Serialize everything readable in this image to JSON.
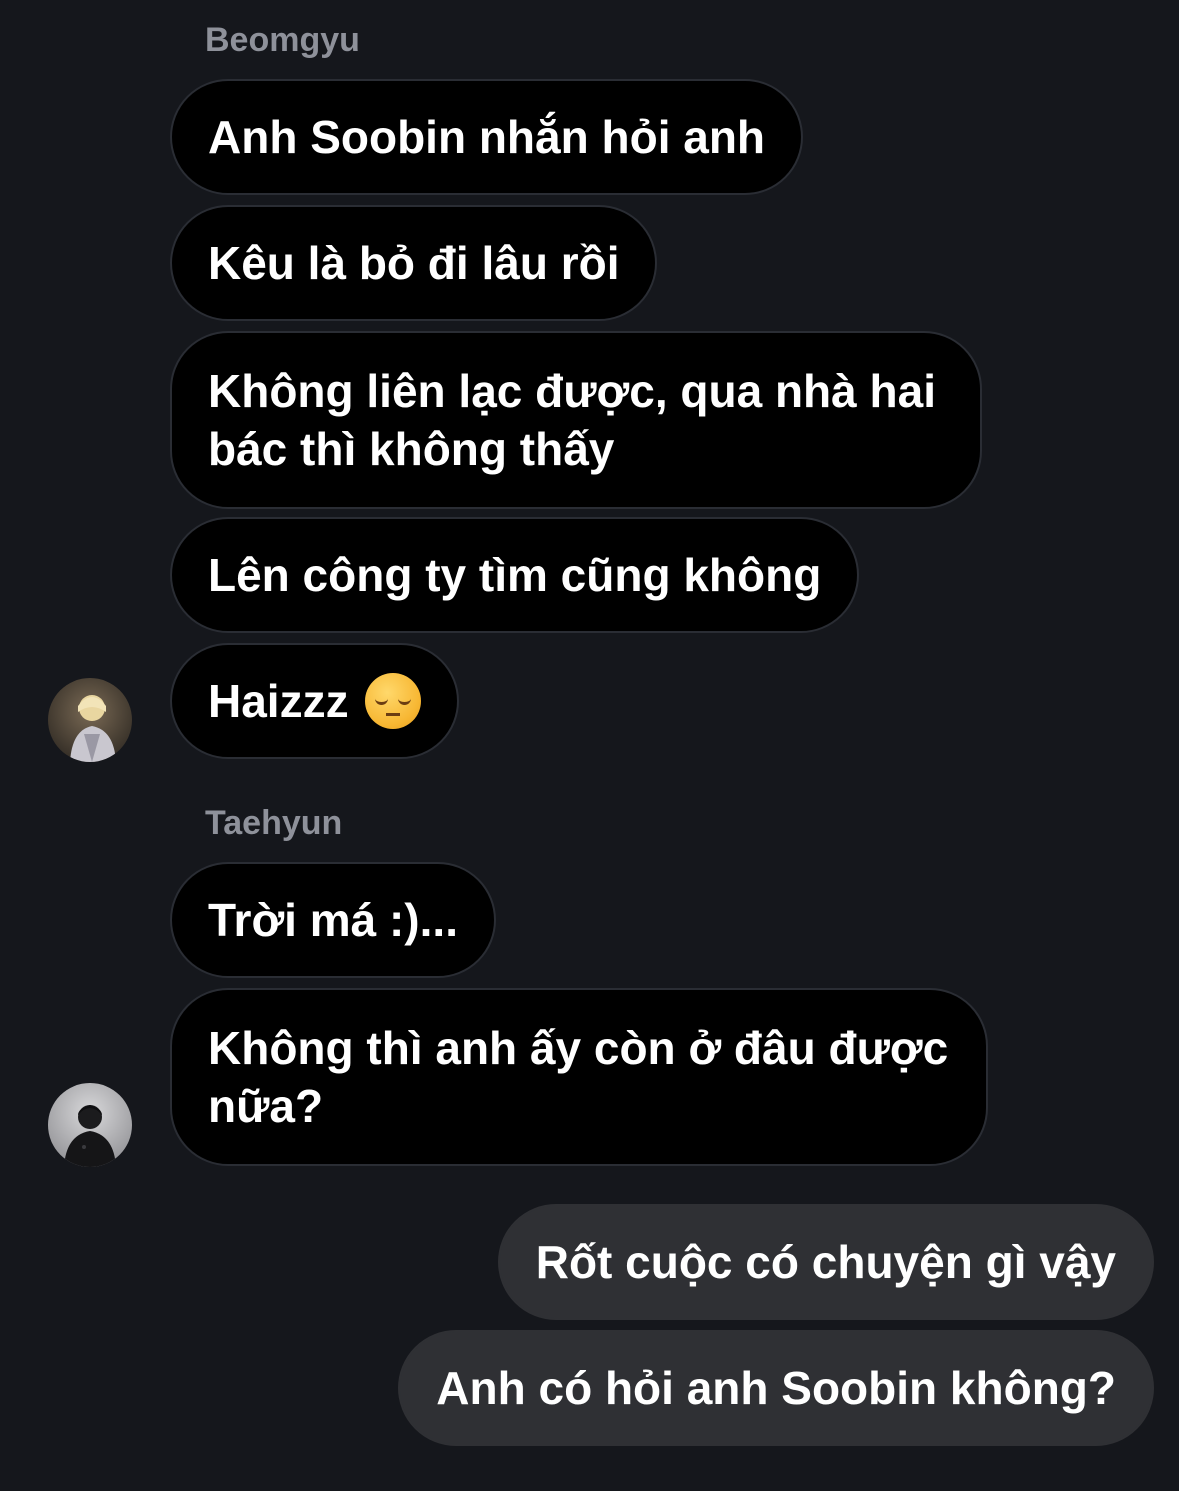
{
  "thread": {
    "groups": [
      {
        "sender": "Beomgyu",
        "avatar_icon": "user-avatar-beomgyu",
        "messages": [
          "Anh Soobin nhắn hỏi anh",
          "Kêu là bỏ đi lâu rồi",
          "Không liên lạc được, qua nhà hai bác thì không thấy",
          "Lên công ty tìm cũng không",
          "Haizzz"
        ],
        "emoji": "pensive-face-icon"
      },
      {
        "sender": "Taehyun",
        "avatar_icon": "user-avatar-taehyun",
        "messages": [
          "Trời má :)...",
          "Không thì anh ấy còn ở đâu được nữa?"
        ]
      }
    ],
    "outgoing": [
      "Rốt cuộc có chuyện gì vậy",
      "Anh có hỏi anh Soobin không?"
    ]
  },
  "colors": {
    "background": "#15171c",
    "incoming_bubble": "#000000",
    "incoming_border": "#2a2d34",
    "outgoing_bubble": "#2f3034",
    "sender_name": "#8e919a",
    "text": "#ffffff"
  }
}
